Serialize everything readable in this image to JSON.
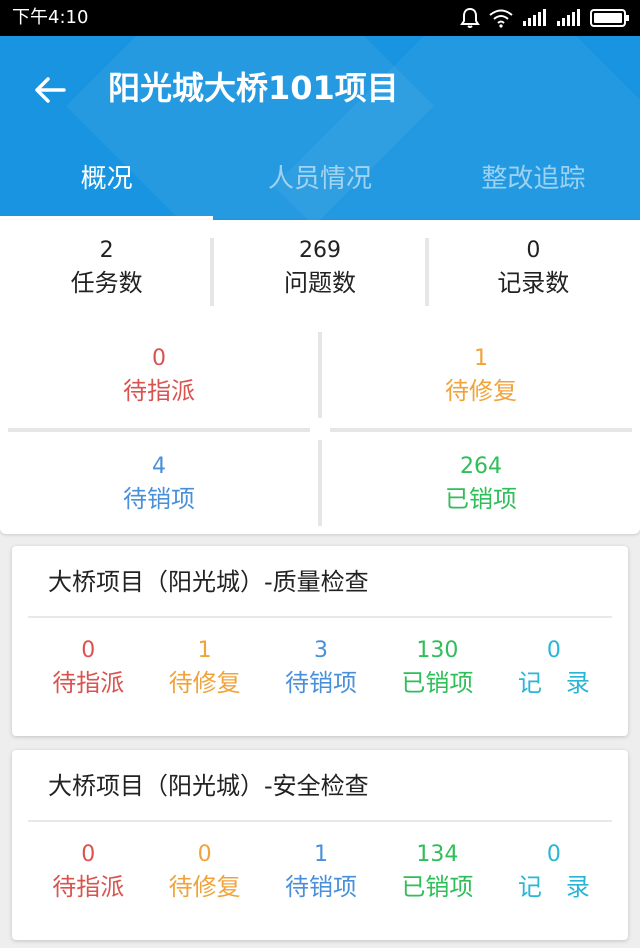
{
  "status_bar": {
    "time": "下午4:10",
    "icons": [
      "alarm-icon",
      "wifi-icon",
      "signal-icon",
      "signal-icon",
      "battery-icon"
    ]
  },
  "header": {
    "title": "阳光城大桥101项目",
    "back_icon": "arrow-left-icon",
    "accent_color": "#1894e0",
    "tabs": [
      {
        "label": "概况",
        "active": true
      },
      {
        "label": "人员情况",
        "active": false
      },
      {
        "label": "整改追踪",
        "active": false
      }
    ]
  },
  "overview": {
    "summary": [
      {
        "value": "2",
        "label": "任务数"
      },
      {
        "value": "269",
        "label": "问题数"
      },
      {
        "value": "0",
        "label": "记录数"
      }
    ],
    "pending_assign": {
      "value": "0",
      "label": "待指派",
      "color": "#d9534f"
    },
    "pending_fix": {
      "value": "1",
      "label": "待修复",
      "color": "#f0a33a"
    },
    "pending_close": {
      "value": "4",
      "label": "待销项",
      "color": "#4a90d9"
    },
    "closed": {
      "value": "264",
      "label": "已销项",
      "color": "#2fbe5a"
    }
  },
  "projects": [
    {
      "title": "大桥项目（阳光城）-质量检查",
      "stats": [
        {
          "value": "0",
          "label": "待指派"
        },
        {
          "value": "1",
          "label": "待修复"
        },
        {
          "value": "3",
          "label": "待销项"
        },
        {
          "value": "130",
          "label": "已销项"
        },
        {
          "value": "0",
          "label": "记　录"
        }
      ]
    },
    {
      "title": "大桥项目（阳光城）-安全检查",
      "stats": [
        {
          "value": "0",
          "label": "待指派"
        },
        {
          "value": "0",
          "label": "待修复"
        },
        {
          "value": "1",
          "label": "待销项"
        },
        {
          "value": "134",
          "label": "已销项"
        },
        {
          "value": "0",
          "label": "记　录"
        }
      ]
    }
  ]
}
